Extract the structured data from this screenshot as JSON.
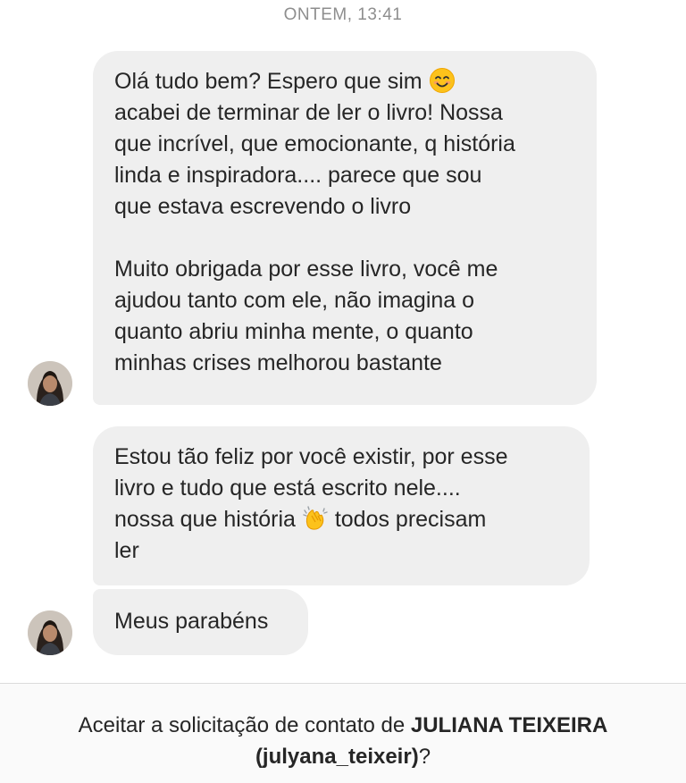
{
  "thread": {
    "timestamp": "ONTEM, 13:41"
  },
  "messages": [
    {
      "lines": [
        "Olá tudo bem? Espero que sim",
        "acabei de terminar de ler o livro! Nossa",
        "que incrível, que emocionante, q história",
        "linda e inspiradora.... parece que sou",
        "que estava escrevendo o livro",
        "",
        "Muito obrigada por esse livro, você me",
        "ajudou tanto com ele, não imagina o",
        "quanto abriu minha mente, o quanto",
        "minhas crises melhorou bastante"
      ],
      "emoji": "smiling-face-emoji"
    },
    {
      "lines": [
        "Estou tão feliz por você existir, por esse",
        "livro e tudo que está escrito nele....",
        "nossa que história",
        "todos precisam",
        "ler"
      ],
      "emoji": "clapping-hands-emoji"
    },
    {
      "lines": [
        "Meus parabéns"
      ]
    }
  ],
  "contact_request": {
    "prefix": "Aceitar a solicitação de contato de ",
    "name": "JULIANA TEIXEIRA",
    "username": "(julyana_teixeir)",
    "suffix": "?"
  },
  "colors": {
    "bubble": "#efefef",
    "text": "#262626",
    "timestamp": "#8e8e8e",
    "request_bar": "#fafafa"
  }
}
